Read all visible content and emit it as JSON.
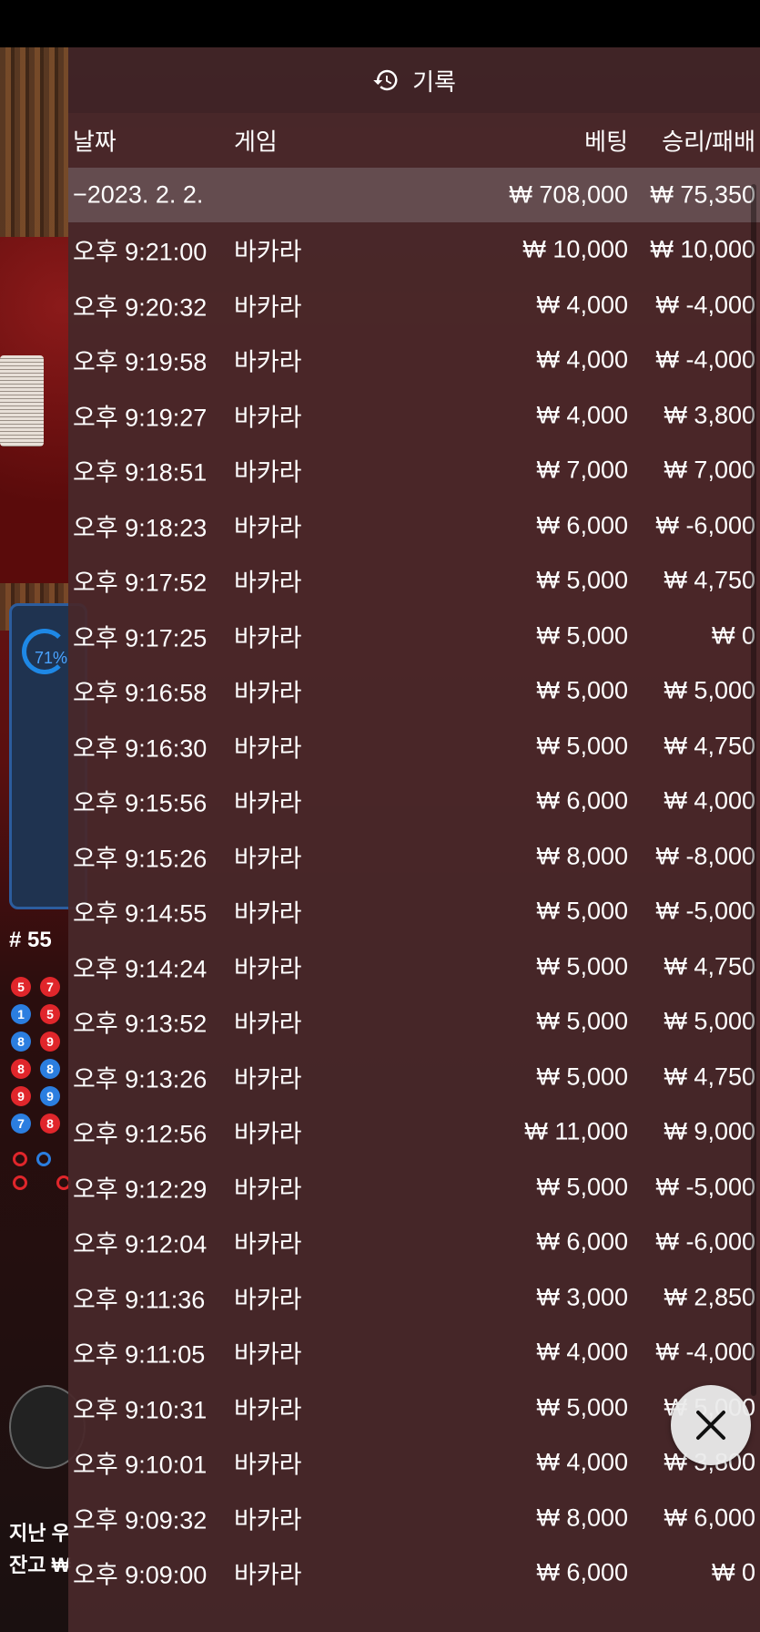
{
  "header": {
    "title": "기록",
    "icon": "history-icon"
  },
  "columns": {
    "date": "날짜",
    "game": "게임",
    "bet": "베팅",
    "winloss": "승리/패배"
  },
  "summary": {
    "date": "−2023. 2. 2.",
    "bet": "₩ 708,000",
    "winloss": "₩ 75,350"
  },
  "rows": [
    {
      "time": "오후 9:21:00",
      "game": "바카라",
      "bet": "₩ 10,000",
      "winloss": "₩ 10,000"
    },
    {
      "time": "오후 9:20:32",
      "game": "바카라",
      "bet": "₩ 4,000",
      "winloss": "₩ -4,000"
    },
    {
      "time": "오후 9:19:58",
      "game": "바카라",
      "bet": "₩ 4,000",
      "winloss": "₩ -4,000"
    },
    {
      "time": "오후 9:19:27",
      "game": "바카라",
      "bet": "₩ 4,000",
      "winloss": "₩ 3,800"
    },
    {
      "time": "오후 9:18:51",
      "game": "바카라",
      "bet": "₩ 7,000",
      "winloss": "₩ 7,000"
    },
    {
      "time": "오후 9:18:23",
      "game": "바카라",
      "bet": "₩ 6,000",
      "winloss": "₩ -6,000"
    },
    {
      "time": "오후 9:17:52",
      "game": "바카라",
      "bet": "₩ 5,000",
      "winloss": "₩ 4,750"
    },
    {
      "time": "오후 9:17:25",
      "game": "바카라",
      "bet": "₩ 5,000",
      "winloss": "₩ 0"
    },
    {
      "time": "오후 9:16:58",
      "game": "바카라",
      "bet": "₩ 5,000",
      "winloss": "₩ 5,000"
    },
    {
      "time": "오후 9:16:30",
      "game": "바카라",
      "bet": "₩ 5,000",
      "winloss": "₩ 4,750"
    },
    {
      "time": "오후 9:15:56",
      "game": "바카라",
      "bet": "₩ 6,000",
      "winloss": "₩ 4,000"
    },
    {
      "time": "오후 9:15:26",
      "game": "바카라",
      "bet": "₩ 8,000",
      "winloss": "₩ -8,000"
    },
    {
      "time": "오후 9:14:55",
      "game": "바카라",
      "bet": "₩ 5,000",
      "winloss": "₩ -5,000"
    },
    {
      "time": "오후 9:14:24",
      "game": "바카라",
      "bet": "₩ 5,000",
      "winloss": "₩ 4,750"
    },
    {
      "time": "오후 9:13:52",
      "game": "바카라",
      "bet": "₩ 5,000",
      "winloss": "₩ 5,000"
    },
    {
      "time": "오후 9:13:26",
      "game": "바카라",
      "bet": "₩ 5,000",
      "winloss": "₩ 4,750"
    },
    {
      "time": "오후 9:12:56",
      "game": "바카라",
      "bet": "₩ 11,000",
      "winloss": "₩ 9,000"
    },
    {
      "time": "오후 9:12:29",
      "game": "바카라",
      "bet": "₩ 5,000",
      "winloss": "₩ -5,000"
    },
    {
      "time": "오후 9:12:04",
      "game": "바카라",
      "bet": "₩ 6,000",
      "winloss": "₩ -6,000"
    },
    {
      "time": "오후 9:11:36",
      "game": "바카라",
      "bet": "₩ 3,000",
      "winloss": "₩ 2,850"
    },
    {
      "time": "오후 9:11:05",
      "game": "바카라",
      "bet": "₩ 4,000",
      "winloss": "₩ -4,000"
    },
    {
      "time": "오후 9:10:31",
      "game": "바카라",
      "bet": "₩ 5,000",
      "winloss": "₩ 5,000"
    },
    {
      "time": "오후 9:10:01",
      "game": "바카라",
      "bet": "₩ 4,000",
      "winloss": "₩ 3,800"
    },
    {
      "time": "오후 9:09:32",
      "game": "바카라",
      "bet": "₩ 8,000",
      "winloss": "₩ 6,000"
    },
    {
      "time": "오후 9:09:00",
      "game": "바카라",
      "bet": "₩ 6,000",
      "winloss": "₩ 0"
    }
  ],
  "background": {
    "progress_label": "71%",
    "round": "# 55",
    "footer_line1": "지난 우",
    "footer_line2": "잔고 ₩"
  },
  "close_button": {
    "icon": "close-icon"
  },
  "colors": {
    "modal_bg": "#48282a",
    "summary_bg": "#6e5a5c",
    "bead_red": "#e0262b",
    "bead_blue": "#2b7ee0"
  }
}
